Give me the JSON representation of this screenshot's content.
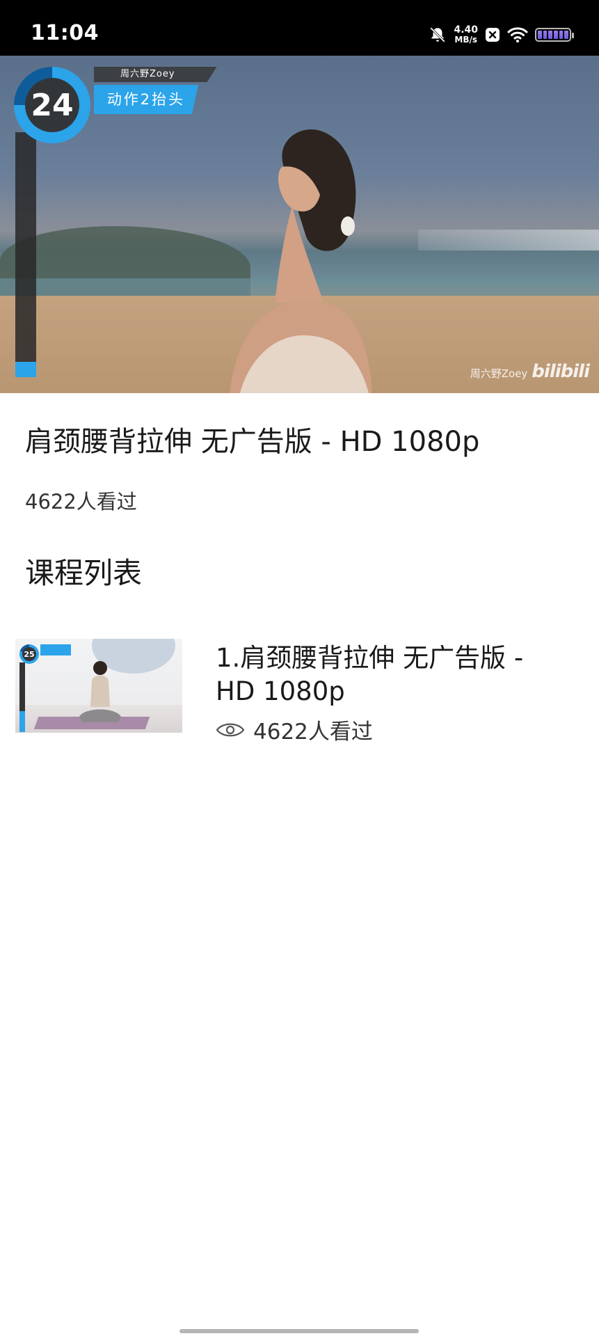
{
  "status_bar": {
    "time": "11:04",
    "net_speed_value": "4.40",
    "net_speed_unit": "MB/s",
    "icons": [
      "mute-bell-icon",
      "close-box-icon",
      "wifi-icon",
      "battery-icon"
    ]
  },
  "hero": {
    "counter": "24",
    "counter_progress": 0.75,
    "creator_tag": "周六野Zoey",
    "action_label": "动作2抬头",
    "watermark_creator": "周六野Zoey",
    "watermark_logo": "bilibili"
  },
  "course": {
    "title": "肩颈腰背拉伸 无广告版 - HD 1080p",
    "views": "4622人看过"
  },
  "section": {
    "title": "课程列表"
  },
  "course_list": [
    {
      "title": "1.肩颈腰背拉伸 无广告版 - HD 1080p",
      "views": "4622人看过",
      "thumb_counter": "25"
    }
  ],
  "colors": {
    "accent": "#2ba4ea",
    "text_primary": "#1a1a1a",
    "status_bar_bg": "#000000"
  }
}
